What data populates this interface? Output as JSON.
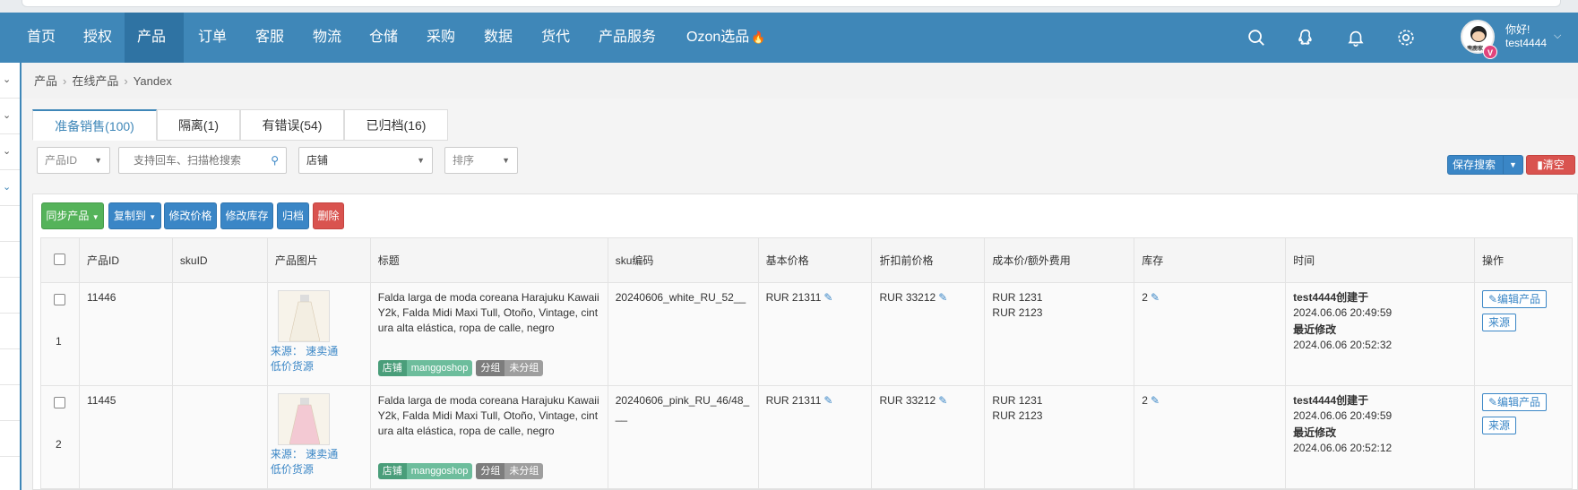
{
  "nav": {
    "items": [
      {
        "label": "首页"
      },
      {
        "label": "授权"
      },
      {
        "label": "产品"
      },
      {
        "label": "订单"
      },
      {
        "label": "客服"
      },
      {
        "label": "物流"
      },
      {
        "label": "仓储"
      },
      {
        "label": "采购"
      },
      {
        "label": "数据"
      },
      {
        "label": "货代"
      },
      {
        "label": "产品服务"
      },
      {
        "label": "Ozon选品"
      }
    ],
    "active_index": 2,
    "user": {
      "greeting": "你好!",
      "name": "test4444",
      "badge": "V",
      "avatar_text": "鹿鹿家"
    },
    "accent": "#3f87b8"
  },
  "breadcrumb": {
    "items": [
      "产品",
      "在线产品",
      "Yandex"
    ]
  },
  "tabs": [
    {
      "label": "准备销售(100)"
    },
    {
      "label": "隔离(1)"
    },
    {
      "label": "有错误(54)"
    },
    {
      "label": "已归档(16)"
    }
  ],
  "filters": {
    "product_id": "产品ID",
    "search_placeholder": "支持回车、扫描枪搜索",
    "shop": "店铺",
    "sort": "排序",
    "save_search": "保存搜索",
    "clear": "清空"
  },
  "actions": {
    "sync": "同步产品",
    "copy_to": "复制到",
    "edit_price": "修改价格",
    "edit_stock": "修改库存",
    "archive": "归档",
    "delete": "删除"
  },
  "table": {
    "headers": [
      "产品ID",
      "skuID",
      "产品图片",
      "标题",
      "sku编码",
      "基本价格",
      "折扣前价格",
      "成本价/额外费用",
      "库存",
      "时间",
      "操作"
    ],
    "rows": [
      {
        "index": "1",
        "product_id": "11446",
        "sku_id": "",
        "source_label": "来源：",
        "source_link": "速卖通",
        "source_line2": "低价货源",
        "title": "Falda larga de moda coreana Harajuku Kawaii Y2k, Falda Midi Maxi Tull, Otoño, Vintage, cintura alta elástica, ropa de calle, negro",
        "shop_key": "店铺",
        "shop_val": "manggoshop",
        "group_key": "分组",
        "group_val": "未分组",
        "sku": "20240606_white_RU_52__",
        "base_price": "RUR  21311",
        "pre_discount": "RUR  33212",
        "cost1": "RUR 1231",
        "cost2": "RUR 2123",
        "stock": "2",
        "created_by": "test4444创建于",
        "created_at": "2024.06.06 20:49:59",
        "modified_label": "最近修改",
        "modified_at": "2024.06.06 20:52:32",
        "op_edit": "编辑产品",
        "op_source": "来源",
        "dress_color": "#f3eee2"
      },
      {
        "index": "2",
        "product_id": "11445",
        "sku_id": "",
        "source_label": "来源：",
        "source_link": "速卖通",
        "source_line2": "低价货源",
        "title": "Falda larga de moda coreana Harajuku Kawaii Y2k, Falda Midi Maxi Tull, Otoño, Vintage, cintura alta elástica, ropa de calle, negro",
        "shop_key": "店铺",
        "shop_val": "manggoshop",
        "group_key": "分组",
        "group_val": "未分组",
        "sku": "20240606_pink_RU_46/48___",
        "base_price": "RUR  21311",
        "pre_discount": "RUR  33212",
        "cost1": "RUR 1231",
        "cost2": "RUR 2123",
        "stock": "2",
        "created_by": "test4444创建于",
        "created_at": "2024.06.06 20:49:59",
        "modified_label": "最近修改",
        "modified_at": "2024.06.06 20:52:12",
        "op_edit": "编辑产品",
        "op_source": "来源",
        "dress_color": "#f3c9d3"
      }
    ]
  }
}
